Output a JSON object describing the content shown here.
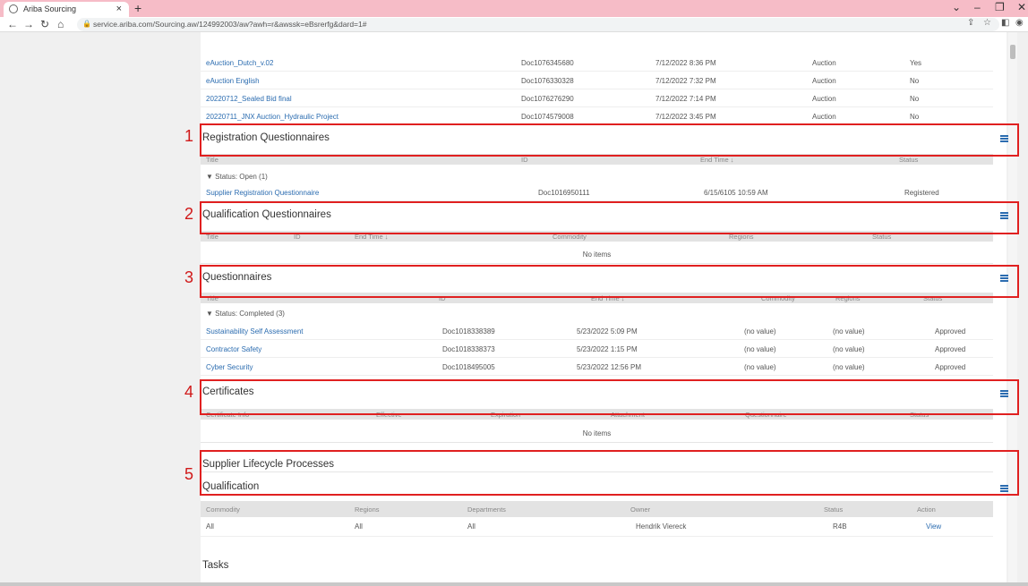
{
  "browser": {
    "tab_title": "Ariba Sourcing",
    "tab_close": "×",
    "new_tab": "+",
    "url": "service.ariba.com/Sourcing.aw/124992003/aw?awh=r&awssk=eBsrerfg&dard=1#"
  },
  "events": [
    {
      "title": "eAuction_Dutch_v.02",
      "id": "Doc1076345680",
      "end_time": "7/12/2022 8:36 PM",
      "type": "Auction",
      "status": "Yes"
    },
    {
      "title": "eAuction English",
      "id": "Doc1076330328",
      "end_time": "7/12/2022 7:32 PM",
      "type": "Auction",
      "status": "No"
    },
    {
      "title": "20220712_Sealed Bid final",
      "id": "Doc1076276290",
      "end_time": "7/12/2022 7:14 PM",
      "type": "Auction",
      "status": "No"
    },
    {
      "title": "20220711_JNX Auction_Hydraulic Project",
      "id": "Doc1074579008",
      "end_time": "7/12/2022 3:45 PM",
      "type": "Auction",
      "status": "No"
    }
  ],
  "registration": {
    "number": "1",
    "title": "Registration Questionnaires",
    "headers": {
      "title": "Title",
      "id": "ID",
      "end_time": "End Time ↓",
      "status": "Status"
    },
    "group": "▼   Status: Open  (1)",
    "rows": [
      {
        "title": "Supplier Registration Questionnaire",
        "id": "Doc1016950111",
        "end_time": "6/15/6105 10:59 AM",
        "status": "Registered"
      }
    ]
  },
  "qualification_q": {
    "number": "2",
    "title": "Qualification Questionnaires",
    "headers": {
      "title": "Title",
      "id": "ID",
      "end_time": "End Time ↓",
      "commodity": "Commodity",
      "regions": "Regions",
      "status": "Status"
    },
    "empty": "No items"
  },
  "questionnaires": {
    "number": "3",
    "title": "Questionnaires",
    "headers": {
      "title": "Title",
      "id": "ID",
      "end_time": "End Time ↓",
      "commodity": "Commodity",
      "regions": "Regions",
      "status": "Status"
    },
    "group": "▼   Status: Completed  (3)",
    "rows": [
      {
        "title": "Sustainability Self Assessment",
        "id": "Doc1018338389",
        "end_time": "5/23/2022 5:09 PM",
        "commodity": "(no value)",
        "regions": "(no value)",
        "status": "Approved"
      },
      {
        "title": "Contractor Safety",
        "id": "Doc1018338373",
        "end_time": "5/23/2022 1:15 PM",
        "commodity": "(no value)",
        "regions": "(no value)",
        "status": "Approved"
      },
      {
        "title": "Cyber Security",
        "id": "Doc1018495005",
        "end_time": "5/23/2022 12:56 PM",
        "commodity": "(no value)",
        "regions": "(no value)",
        "status": "Approved"
      }
    ]
  },
  "certificates": {
    "number": "4",
    "title": "Certificates",
    "headers": {
      "info": "Certificate Info",
      "effective": "Effective",
      "expiration": "Expiration",
      "attachment": "Attachment",
      "questionnaire": "Questionnaire",
      "status": "Status"
    },
    "empty": "No items"
  },
  "lifecycle": {
    "number": "5",
    "title": "Supplier Lifecycle Processes",
    "subtitle": "Qualification",
    "headers": {
      "commodity": "Commodity",
      "regions": "Regions",
      "departments": "Departments",
      "owner": "Owner",
      "status": "Status",
      "action": "Action"
    },
    "rows": [
      {
        "commodity": "All",
        "regions": "All",
        "departments": "All",
        "owner": "Hendrik Viereck",
        "status": "R4B",
        "action": "View"
      }
    ]
  },
  "tasks": {
    "title": "Tasks"
  },
  "colors": {
    "highlight": "#e02020",
    "link": "#2b6cb0",
    "tabbar": "#f6bcc7"
  }
}
